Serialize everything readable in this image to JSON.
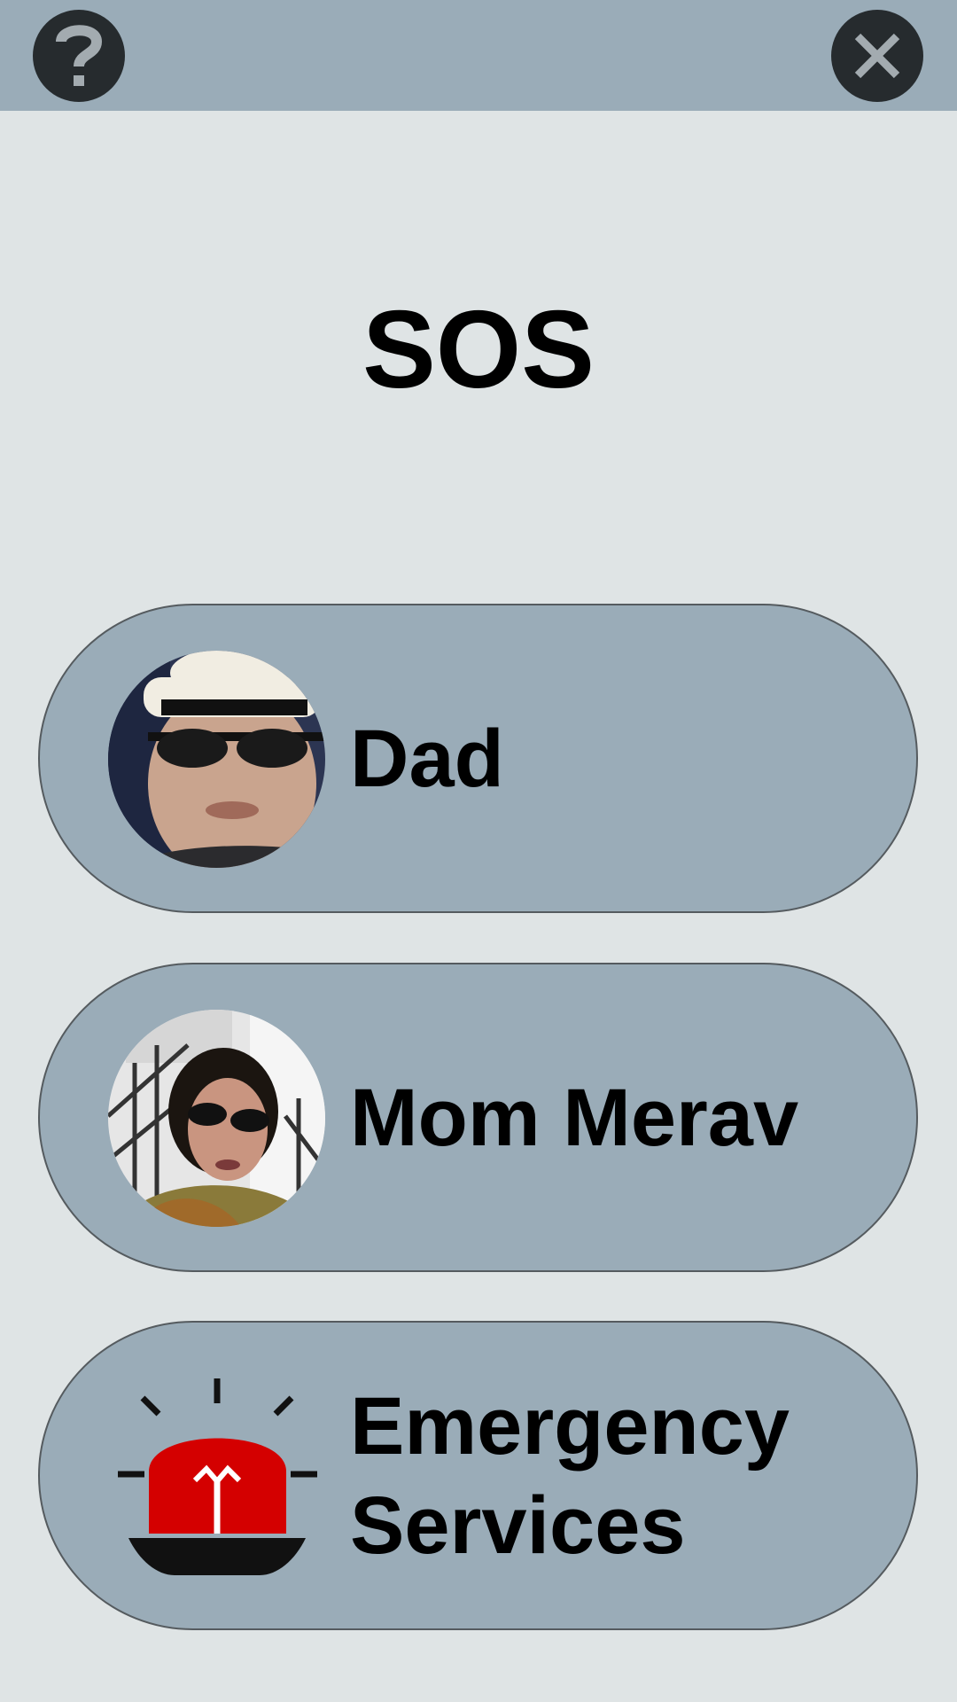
{
  "header": {
    "help_icon": "question-mark-icon",
    "close_icon": "close-x-icon"
  },
  "title": "SOS",
  "contacts": [
    {
      "label": "Dad",
      "icon": "avatar-dad-photo"
    },
    {
      "label": "Mom Merav",
      "icon": "avatar-mom-photo"
    },
    {
      "label": "Emergency Services",
      "icon": "siren-icon"
    }
  ],
  "colors": {
    "background": "#dfe4e5",
    "bar": "#9aacb8",
    "button_dark": "#262b2e",
    "siren_red": "#d40000"
  }
}
